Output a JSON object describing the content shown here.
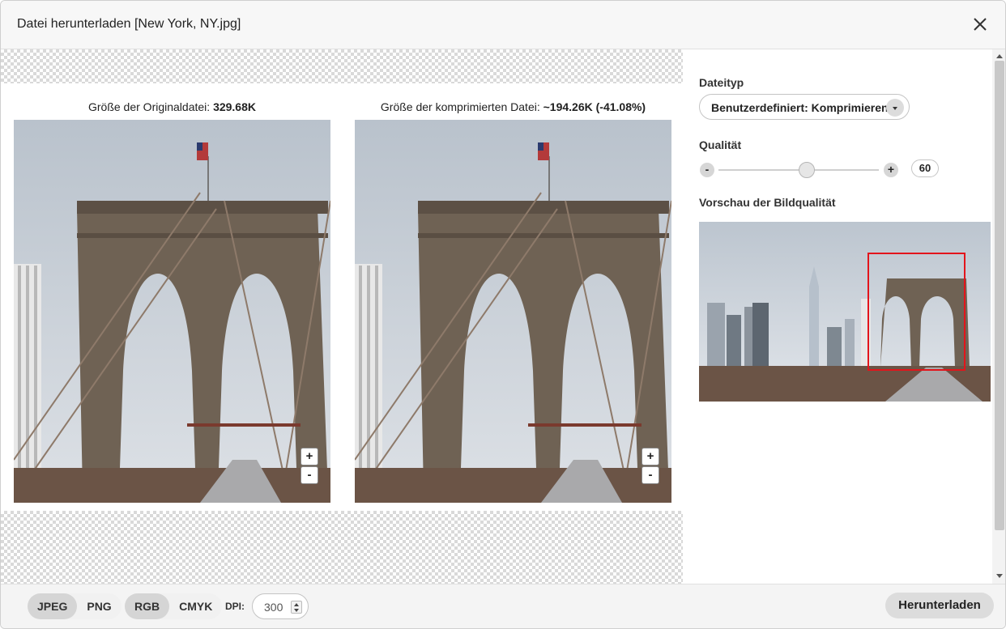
{
  "dialog": {
    "title": "Datei herunterladen [New York, NY.jpg]",
    "close_icon": "close-icon"
  },
  "compare": {
    "original_prefix": "Größe der Originaldatei: ",
    "original_size": "329.68K",
    "compressed_prefix": "Größe der komprimierten Datei: ",
    "compressed_size": "~194.26K (-41.08%)",
    "zoom_in": "+",
    "zoom_out": "-"
  },
  "settings": {
    "filetype_label": "Dateityp",
    "filetype_value": "Benutzerdefiniert: Komprimieren",
    "quality_label": "Qualität",
    "quality_minus": "-",
    "quality_plus": "+",
    "quality_value": "60",
    "quality_fraction": 0.55,
    "preview_label": "Vorschau der Bildqualität"
  },
  "footer": {
    "format_options": [
      "JPEG",
      "PNG"
    ],
    "format_selected": "JPEG",
    "color_options": [
      "RGB",
      "CMYK"
    ],
    "color_selected": "RGB",
    "dpi_label": "DPI:",
    "dpi_value": "300",
    "download_label": "Herunterladen"
  },
  "colors": {
    "preview_frame": "#e3141b",
    "sky": "#c9cfd6",
    "stone": "#6f6254"
  }
}
